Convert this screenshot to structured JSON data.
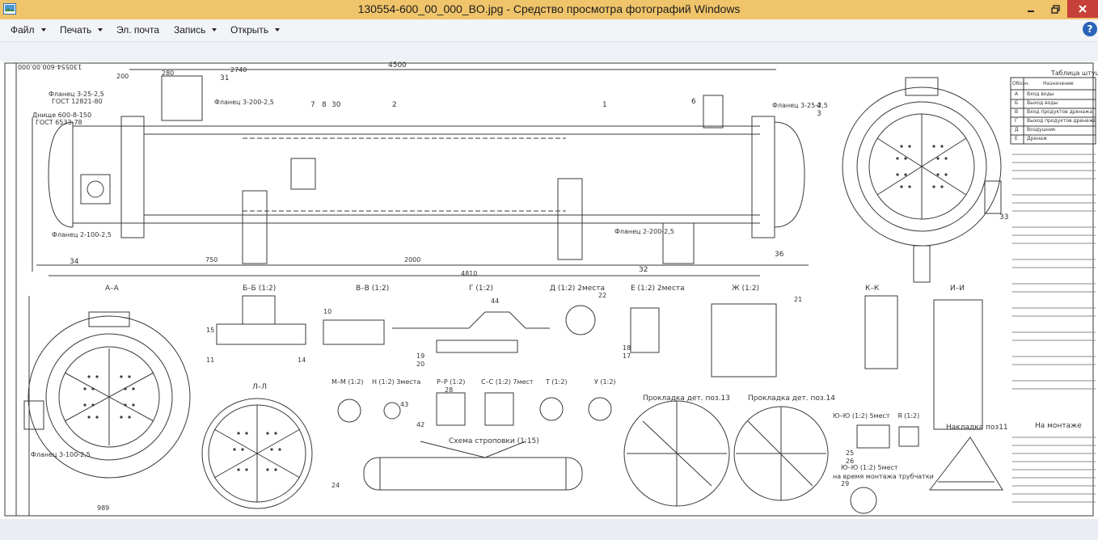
{
  "window": {
    "title": "130554-600_00_000_BO.jpg - Средство просмотра фотографий Windows"
  },
  "menu": {
    "items": [
      {
        "label": "Файл",
        "has_dropdown": true
      },
      {
        "label": "Печать",
        "has_dropdown": true
      },
      {
        "label": "Эл. почта",
        "has_dropdown": false
      },
      {
        "label": "Запись",
        "has_dropdown": true
      },
      {
        "label": "Открыть",
        "has_dropdown": true
      }
    ],
    "help_label": "?"
  },
  "drawing": {
    "stamp": "130554-600.00.000",
    "dims": {
      "overall_length": "4500",
      "len_2740": "2740",
      "len_2000": "2000",
      "len_4810": "4810",
      "len_750": "750",
      "len_280": "280",
      "len_200": "200",
      "len_989": "989"
    },
    "flange_labels": {
      "flange_upper_left": "Фланец 3-25-2,5",
      "gost_12821": "ГОСТ 12821-80",
      "flange_3_200": "Фланец 3-200-2,5",
      "bottom_flange": "Фланец 2-100-2,5",
      "dnishche": "Днище 600-8-150",
      "gost_6533": "ГОСТ 6533-78",
      "flange_right_top": "Фланец 3-25-2,5",
      "flange_right_bottom": "Фланец 2-200-2,5",
      "flange_3_100": "Фланец 3-100-2,5"
    },
    "table_title": "Таблица штуцеров",
    "nozzle_table": {
      "headers": [
        "Обозн.",
        "Назначение"
      ],
      "rows": [
        [
          "А",
          "Вход воды"
        ],
        [
          "Б",
          "Выход воды"
        ],
        [
          "В",
          "Вход продуктов дренажа"
        ],
        [
          "Г",
          "Выход продуктов дренажа"
        ],
        [
          "Д",
          "Воздушник"
        ],
        [
          "Е",
          "Дренаж"
        ]
      ]
    },
    "section_titles": {
      "aa": "А–А",
      "bb": "Б–Б (1:2)",
      "vv": "В–В (1:2)",
      "g": "Г (1:2)",
      "d": "Д (1:2) 2места",
      "e": "Е (1:2) 2места",
      "zh": "Ж (1:2)",
      "kk": "К–К",
      "ii": "И–И",
      "ll": "Л–Л",
      "mm": "М–М (1:2)",
      "n": "Н (1:2) 3места",
      "pr": "Р–Р (1:2)",
      "ss": "С–С (1:2) 7мест",
      "t": "Т (1:2)",
      "u": "У (1:2)",
      "gasket13": "Прокладка дет. поз.13",
      "gasket14": "Прокладка дет. поз.14",
      "yuyu": "Ю–Ю (1:2) 5мест",
      "ya": "Я (1:2)",
      "pad11": "Накладка поз11",
      "sling": "Схема строповки (1:15)",
      "during_assembly": "Ю–Ю (1:2) 5мест",
      "assembly_note": "на время монтажа трубчатки"
    },
    "notes_heading": "На монтаже",
    "callouts": [
      "2",
      "7",
      "8",
      "30",
      "1",
      "6",
      "4",
      "3",
      "34",
      "33",
      "31",
      "36",
      "32",
      "42",
      "43",
      "44",
      "10",
      "11",
      "14",
      "15",
      "17",
      "18",
      "19",
      "20",
      "21",
      "22",
      "24",
      "25",
      "26",
      "28",
      "29"
    ]
  },
  "colors": {
    "titlebar": "#f0c46a",
    "close_button": "#c7403a",
    "menubar": "#f2f4f8",
    "help_button": "#2a62b8"
  }
}
